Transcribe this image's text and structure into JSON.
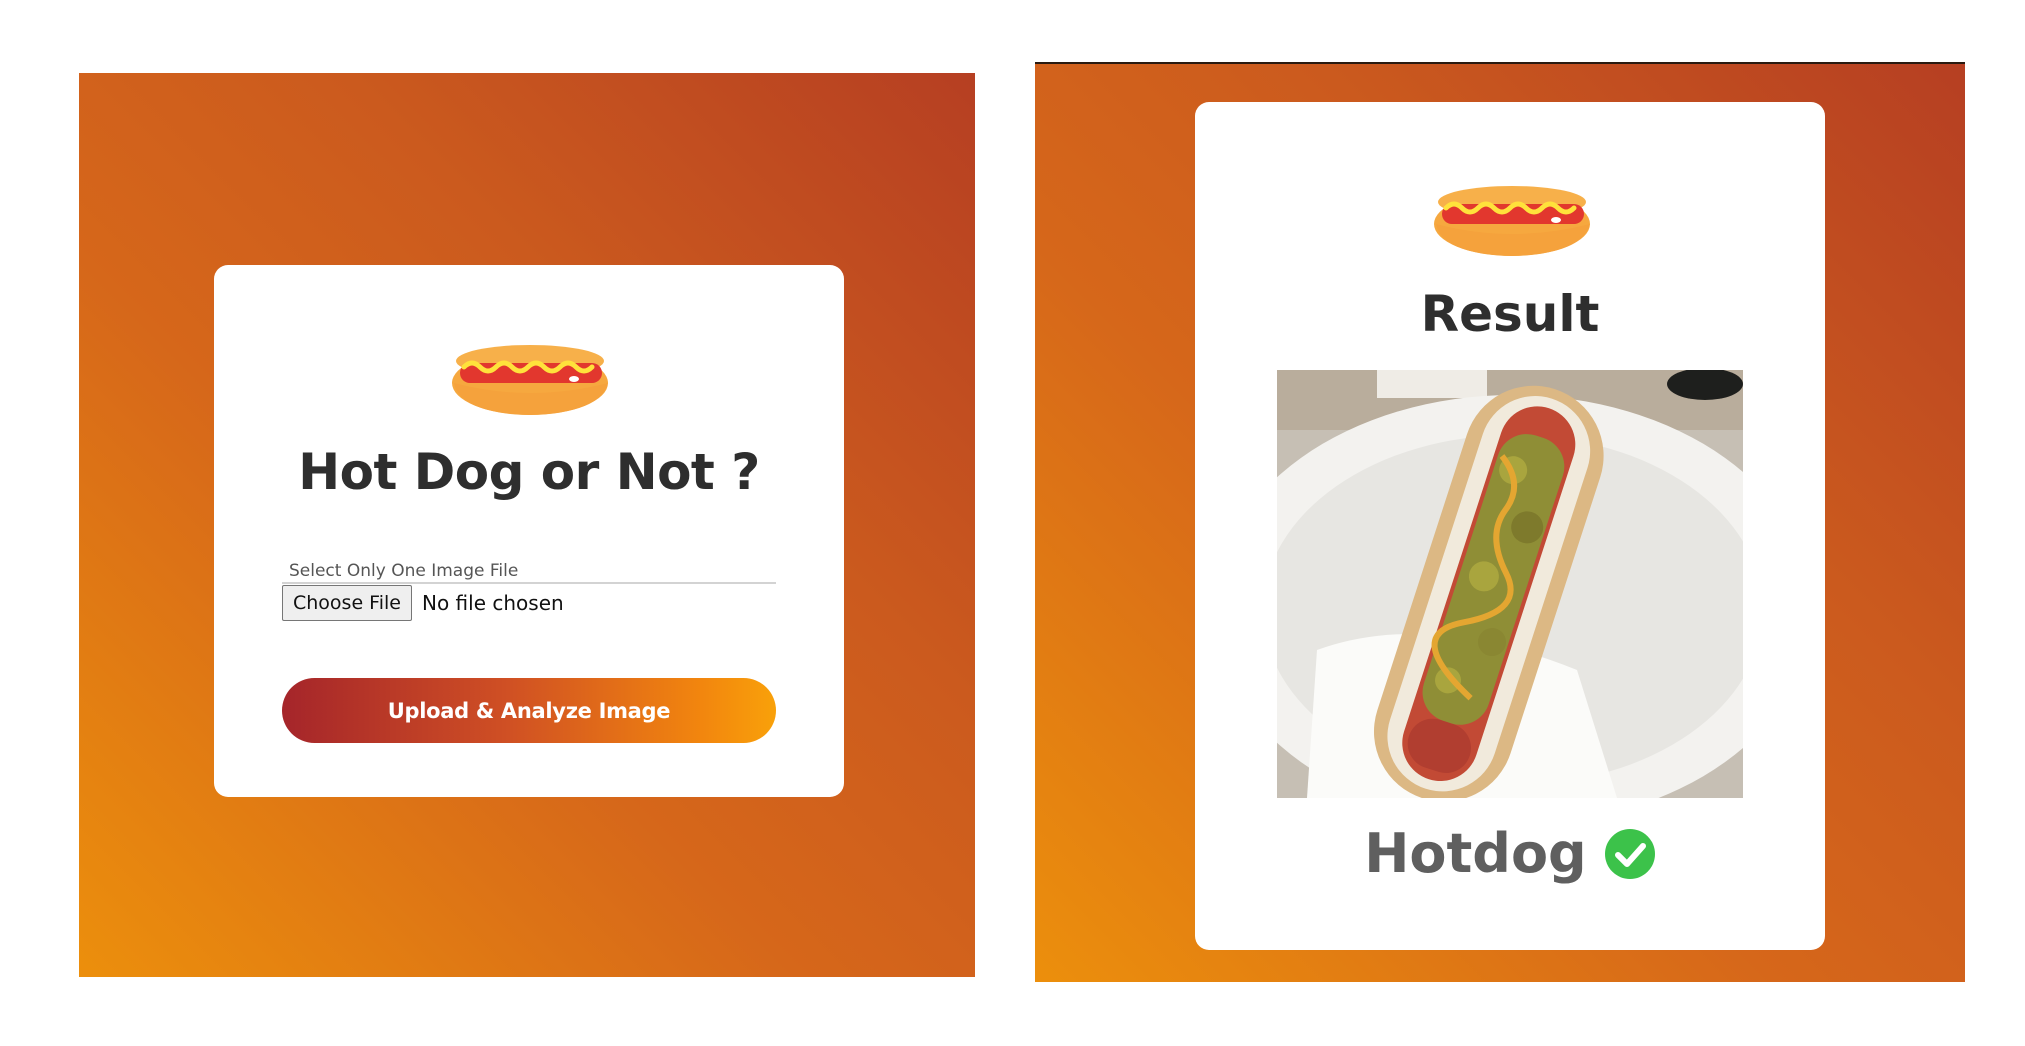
{
  "upload_panel": {
    "title": "Hot Dog or Not ?",
    "file_label": "Select Only One Image File",
    "choose_file_label": "Choose File",
    "file_status": "No file chosen",
    "analyze_button_label": "Upload & Analyze Image",
    "icon": "hotdog-icon"
  },
  "result_panel": {
    "title": "Result",
    "verdict": "Hotdog",
    "verdict_icon": "check-icon",
    "icon": "hotdog-icon"
  },
  "colors": {
    "background_gradient_start": "#ec8f0c",
    "background_gradient_end": "#b63f22",
    "button_gradient_start": "#a5252a",
    "button_gradient_end": "#f9a10a",
    "check_green": "#3cc24a",
    "title_text": "#2e2e2e"
  }
}
